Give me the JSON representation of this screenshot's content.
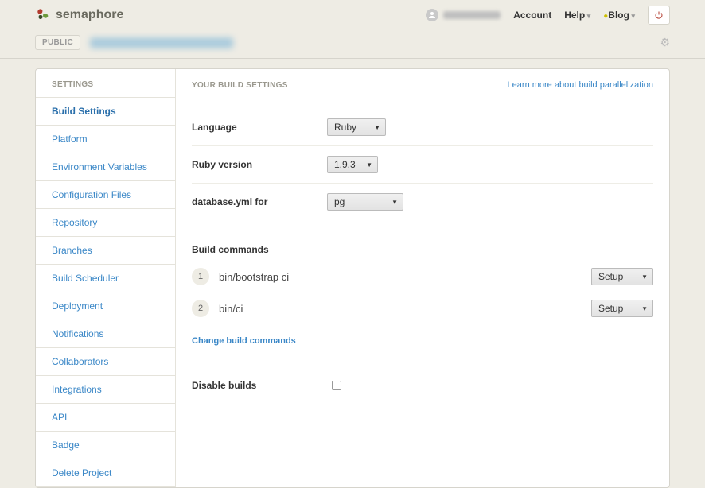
{
  "brand": "semaphore",
  "nav": {
    "account": "Account",
    "help": "Help",
    "blog": "Blog"
  },
  "breadcrumb": {
    "public_badge": "PUBLIC"
  },
  "sidebar": {
    "heading": "SETTINGS",
    "items": [
      "Build Settings",
      "Platform",
      "Environment Variables",
      "Configuration Files",
      "Repository",
      "Branches",
      "Build Scheduler",
      "Deployment",
      "Notifications",
      "Collaborators",
      "Integrations",
      "API",
      "Badge",
      "Delete Project"
    ]
  },
  "content": {
    "heading": "YOUR BUILD SETTINGS",
    "learn_link": "Learn more about build parallelization",
    "language_label": "Language",
    "language_value": "Ruby",
    "ruby_label": "Ruby version",
    "ruby_value": "1.9.3",
    "db_label": "database.yml for",
    "db_value": "pg",
    "build_commands_label": "Build commands",
    "commands": [
      {
        "n": "1",
        "text": "bin/bootstrap ci",
        "stage": "Setup"
      },
      {
        "n": "2",
        "text": "bin/ci",
        "stage": "Setup"
      }
    ],
    "change_link": "Change build commands",
    "disable_label": "Disable builds"
  }
}
